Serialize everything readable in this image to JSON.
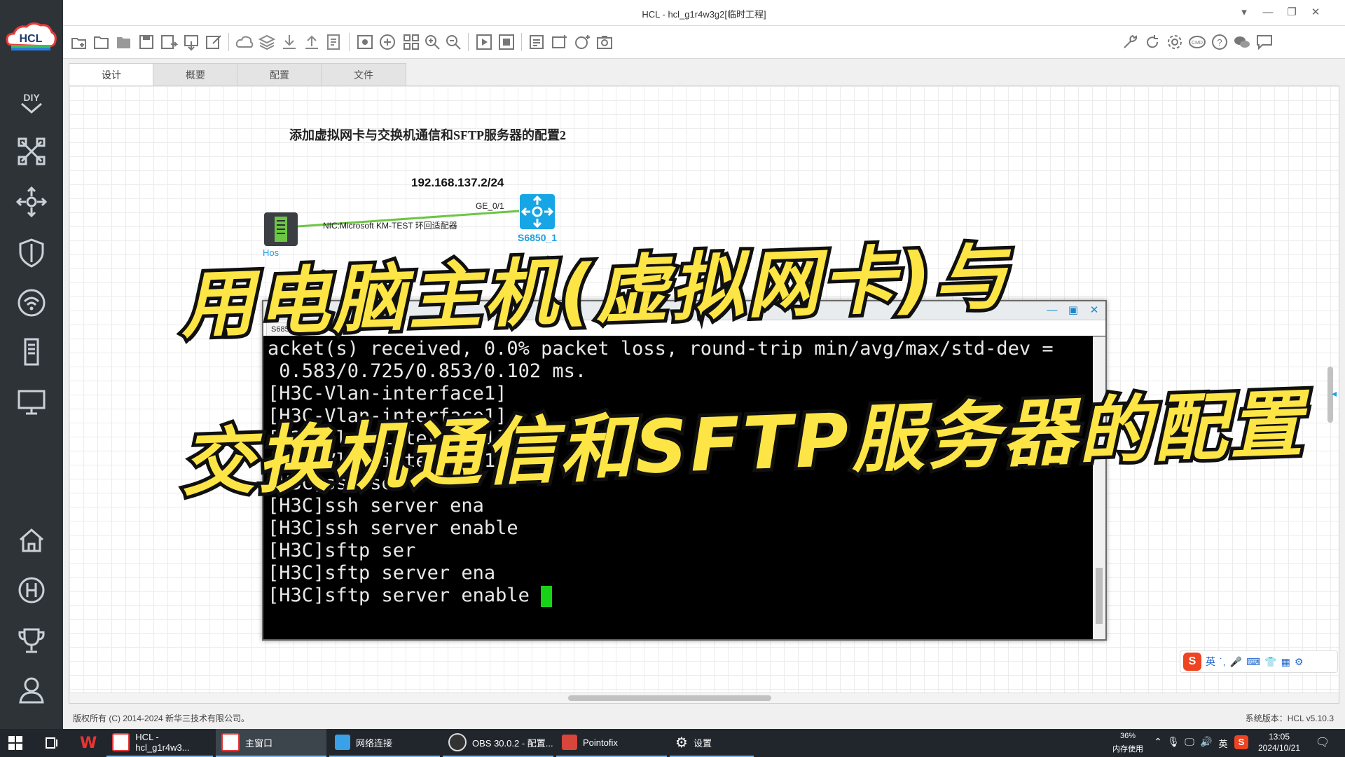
{
  "app": {
    "logo_text": "HCL",
    "window_title": "HCL - hcl_g1r4w3g2[临时工程]"
  },
  "sidebar": {
    "items": [
      {
        "name": "diy-icon"
      },
      {
        "name": "network-topology-icon"
      },
      {
        "name": "router-icon"
      },
      {
        "name": "security-shield-icon"
      },
      {
        "name": "wireless-icon"
      },
      {
        "name": "server-icon"
      },
      {
        "name": "terminal-host-icon"
      },
      {
        "name": "home-icon"
      },
      {
        "name": "h3c-logo-icon"
      },
      {
        "name": "trophy-icon"
      },
      {
        "name": "user-icon"
      }
    ]
  },
  "tabs": [
    {
      "label": "设计",
      "active": true
    },
    {
      "label": "概要",
      "active": false
    },
    {
      "label": "配置",
      "active": false
    },
    {
      "label": "文件",
      "active": false
    }
  ],
  "diagram": {
    "title": "添加虚拟网卡与交换机通信和SFTP服务器的配置2",
    "switch_ip": "192.168.137.2/24",
    "port_label": "GE_0/1",
    "nic_label": "NIC:Microsoft KM-TEST 环回适配器",
    "host_label": "Hos",
    "host_ip_partial_a": "2.",
    "host_ip_partial_b": "2",
    "switch_label": "S6850_1",
    "switch_extra": "务"
  },
  "terminal": {
    "title": "g1r4w3g2",
    "tab_label": "S6850_1",
    "lines": [
      "acket(s) received, 0.0% packet loss, round-trip min/avg/max/std-dev =",
      " 0.583/0.725/0.853/0.102 ms.",
      "",
      "[H3C-Vlan-interface1]",
      "[H3C-Vlan-interface1]",
      "[H3C-Vlan-interface1]",
      "[H3C-Vlan-interface1]quit",
      "[H3C]ssh ser",
      "[H3C]ssh server ena",
      "[H3C]ssh server enable",
      "[H3C]sftp ser",
      "[H3C]sftp server ena",
      "[H3C]sftp server enable "
    ]
  },
  "overlay": {
    "line1": "用电脑主机(虚拟网卡)与",
    "line2": "交换机通信和SFTP服务器的配置"
  },
  "statusbar": {
    "copyright": "版权所有 (C) 2014-2024 新华三技术有限公司。",
    "version": "系统版本：HCL v5.10.3"
  },
  "ime": {
    "logo": "S",
    "lang": "英"
  },
  "taskbar": {
    "apps": [
      {
        "label": "HCL - hcl_g1r4w3...",
        "color": "#1e6fd9"
      },
      {
        "label": "主窗口",
        "color": "#1e6fd9"
      },
      {
        "label": "网络连接",
        "color": "#3aa0e8"
      },
      {
        "label": "OBS 30.0.2 - 配置...",
        "color": "#333333"
      },
      {
        "label": "Pointofix",
        "color": "#d8453a"
      },
      {
        "label": "设置",
        "color": "#ffffff"
      }
    ],
    "memory_percent": "36%",
    "memory_label": "内存使用",
    "lang": "英",
    "time": "13:05",
    "date": "2024/10/21"
  },
  "colors": {
    "accent_cyan": "#1da1e0",
    "overlay_yellow": "#fce545",
    "cursor_green": "#18d218",
    "link_green": "#6cc644"
  }
}
